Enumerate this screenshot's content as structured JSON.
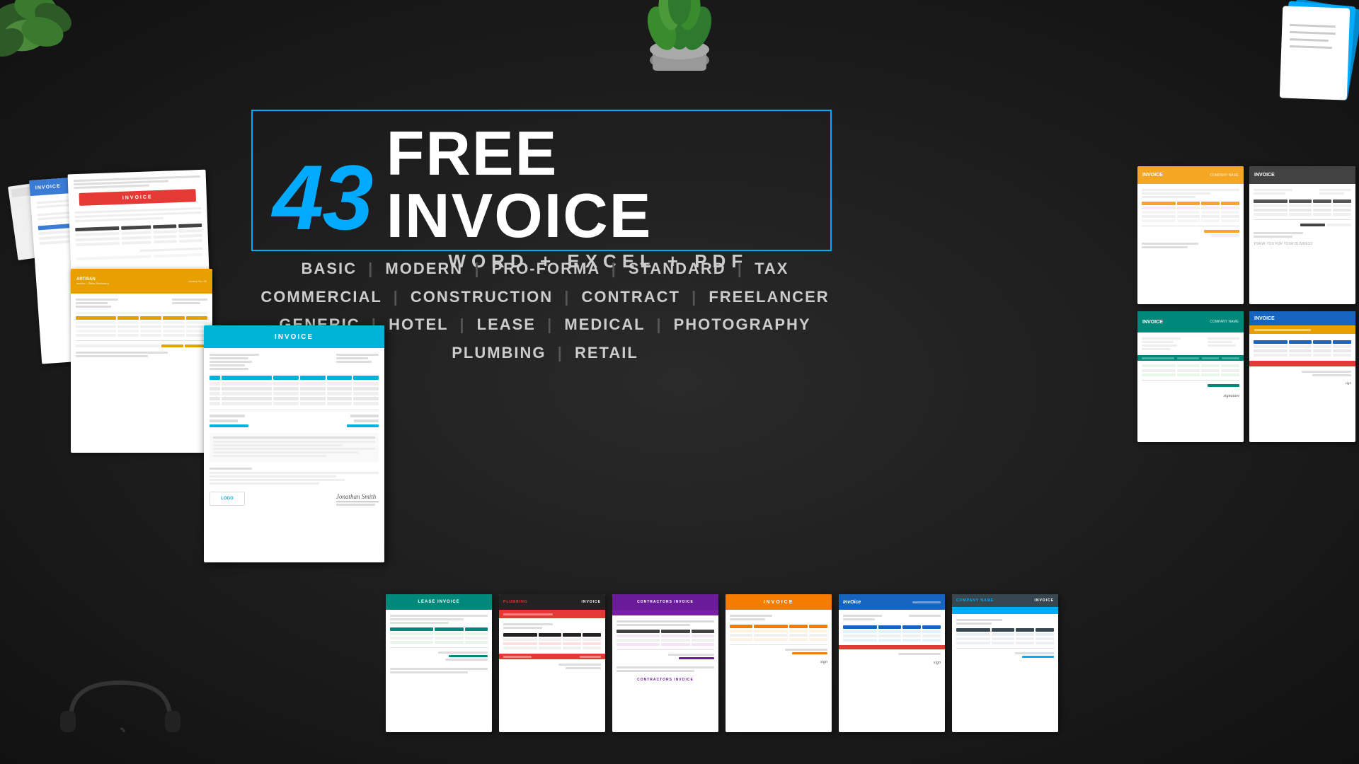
{
  "page": {
    "background_color": "#1a1a1a"
  },
  "headline": {
    "number": "43",
    "free_invoice": "FREE INVOICE",
    "formats": "WORD  +  EXCEL  +  PDF"
  },
  "categories": {
    "line1_items": [
      "BASIC",
      "MODERN",
      "PRO-FORMA",
      "STANDARD",
      "TAX"
    ],
    "line2_items": [
      "COMMERCIAL",
      "CONSTRUCTION",
      "CONTRACT",
      "FREELANCER"
    ],
    "line3_items": [
      "GENERIC",
      "HOTEL",
      "LEASE",
      "MEDICAL",
      "PHOTOGRAPHY"
    ],
    "line4_items": [
      "PLUMBING",
      "RETAIL"
    ]
  },
  "thumbnails": {
    "thumb1_title": "INVOICE",
    "thumb2_title": "INVOICE",
    "thumb3_title": "ARTISAN",
    "thumb4_title": "INVOICE",
    "main_invoice_title": "INVOICE",
    "contractors_title": "CONTRACTORS INVOICE",
    "invoice_label": "InvOice",
    "lease_title": "LEASE INVOICE",
    "plumbing_title": "PLUMBING INVOICE"
  },
  "colors": {
    "accent_blue": "#00aaff",
    "orange": "#e8a000",
    "teal": "#00b4d8",
    "red": "#e53935",
    "purple": "#6a1b9a",
    "dark_bg": "#1a1a1a",
    "gray_header": "#424242",
    "green_teal": "#00897b"
  }
}
